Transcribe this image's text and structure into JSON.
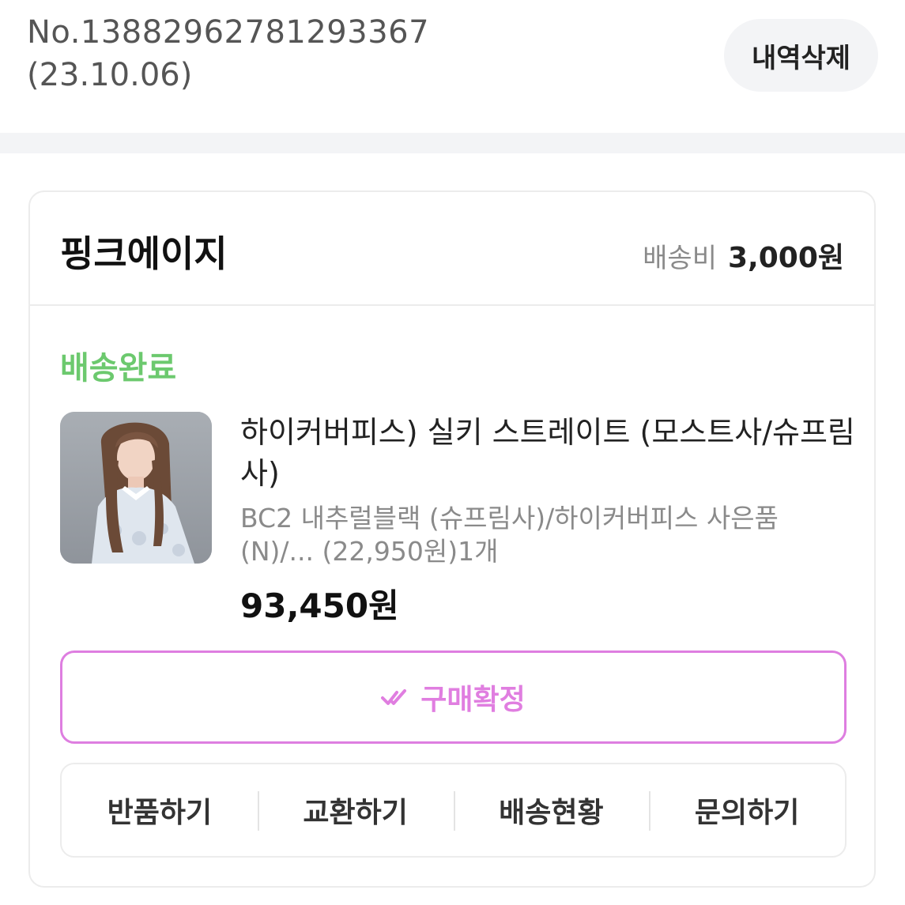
{
  "order": {
    "number": "No.13882962781293367",
    "date": "(23.10.06)",
    "delete_label": "내역삭제"
  },
  "seller": {
    "name": "핑크에이지",
    "shipping_label": "배송비",
    "shipping_value": "3,000원"
  },
  "status": {
    "text": "배송완료",
    "color": "#6cc96e"
  },
  "product": {
    "name": "하이커버피스) 실키 스트레이트 (모스트사/슈프림사)",
    "option": "BC2 내추럴블랙 (슈프림사)/하이커버피스 사은품(N)/... (22,950원)1개",
    "price": "93,450원"
  },
  "confirm": {
    "label": "구매확정",
    "icon": "double-check-icon",
    "accent": "#e07ee0"
  },
  "actions": [
    {
      "label": "반품하기"
    },
    {
      "label": "교환하기"
    },
    {
      "label": "배송현황"
    },
    {
      "label": "문의하기"
    }
  ]
}
